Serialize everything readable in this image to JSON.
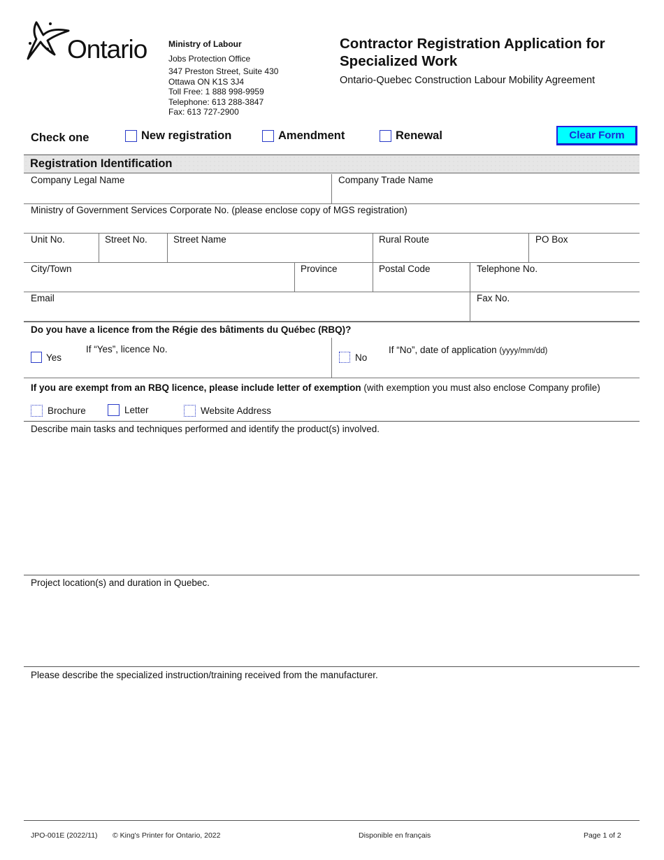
{
  "header": {
    "logo_text": "Ontario",
    "ministry": "Ministry of Labour",
    "office": "Jobs Protection Office",
    "address_lines": [
      "347 Preston Street, Suite 430",
      "Ottawa  ON  K1S 3J4",
      "Toll Free: 1 888 998-9959",
      "Telephone: 613 288-3847",
      "Fax: 613 727-2900"
    ],
    "title": "Contractor Registration Application for Specialized Work",
    "subtitle": "Ontario-Quebec Construction Labour Mobility Agreement"
  },
  "check_one": {
    "label": "Check one",
    "options": [
      {
        "label": "New registration",
        "checked": false
      },
      {
        "label": "Amendment",
        "checked": false
      },
      {
        "label": "Renewal",
        "checked": false
      }
    ]
  },
  "clear_form_label": "Clear Form",
  "section": {
    "title": "Registration Identification"
  },
  "fields": {
    "company_legal_name": "Company Legal Name",
    "company_trade_name": "Company Trade Name",
    "mgs_corporate_no": "Ministry of Government Services Corporate No. (please enclose copy of MGS registration)",
    "unit_no": "Unit No.",
    "street_no": "Street No.",
    "street_name": "Street Name",
    "rural_route": "Rural Route",
    "po_box": "PO Box",
    "city_town": "City/Town",
    "province": "Province",
    "postal_code": "Postal Code",
    "telephone_no": "Telephone No.",
    "email": "Email",
    "fax_no": "Fax No."
  },
  "rbq": {
    "question": "Do you have a licence from the Régie des bâtiments du Québec (RBQ)?",
    "yes_label": "Yes",
    "yes_prompt": "If “Yes”, licence No.",
    "no_label": "No",
    "no_prompt": "If “No”, date of application",
    "no_prompt_format": "(yyyy/mm/dd)"
  },
  "exemption": {
    "bold_text": "If you are exempt from an RBQ licence, please include letter of exemption",
    "normal_text": " (with exemption you must also enclose Company profile)",
    "options": [
      {
        "label": "Brochure",
        "checked": false
      },
      {
        "label": "Letter",
        "checked": false
      },
      {
        "label": "Website Address",
        "checked": false
      }
    ]
  },
  "descriptions": {
    "main_tasks": "Describe main tasks and techniques performed and identify the product(s) involved.",
    "project_location": "Project location(s) and duration in Quebec.",
    "training": "Please describe the specialized instruction/training received from the manufacturer."
  },
  "footer": {
    "form_id": "JPO-001E (2022/11)",
    "copyright": "© King's Printer for Ontario, 2022",
    "french": "Disponible en français",
    "page": "Page 1 of 2"
  },
  "colors": {
    "checkbox_border": "#2a3cc8",
    "clear_button_bg": "#00ffff",
    "clear_button_text": "#1a2bd6",
    "section_bg": "#e6e6e6"
  }
}
